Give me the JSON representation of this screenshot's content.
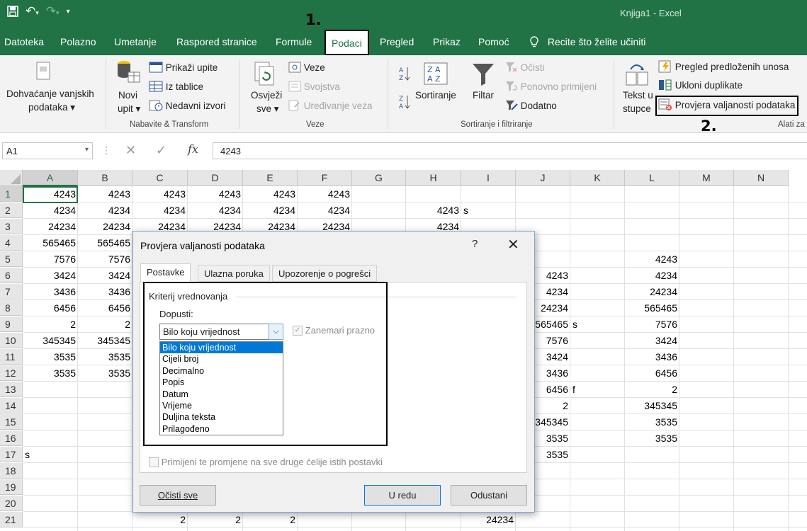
{
  "window": {
    "title": "Knjiga1  -  Excel"
  },
  "annotations": {
    "step1": "1.",
    "step2": "2."
  },
  "tabs": [
    {
      "label": "Datoteka"
    },
    {
      "label": "Polazno"
    },
    {
      "label": "Umetanje"
    },
    {
      "label": "Raspored stranice"
    },
    {
      "label": "Formule"
    },
    {
      "label": "Podaci",
      "active": true
    },
    {
      "label": "Pregled"
    },
    {
      "label": "Prikaz"
    },
    {
      "label": "Pomoć"
    }
  ],
  "tell_me": "Recite što želite učiniti",
  "ribbon": {
    "get_external": [
      "Dohvaćanje vanjskih",
      "podataka ▾"
    ],
    "new_query": [
      "Novi",
      "upit ▾"
    ],
    "show_queries": "Prikaži upite",
    "from_table": "Iz tablice",
    "recent_sources": "Nedavni izvori",
    "group_transform": "Nabavite & Transform",
    "refresh": [
      "Osvježi",
      "sve ▾"
    ],
    "connections": "Veze",
    "properties": "Svojstva",
    "edit_links": "Uređivanje veza",
    "group_connections": "Veze",
    "sort": "Sortiranje",
    "filter": "Filtar",
    "clear": "Očisti",
    "reapply": "Ponovno primijeni",
    "advanced": "Dodatno",
    "group_sort": "Sortiranje i filtriranje",
    "text_to_columns": [
      "Tekst u",
      "stupce"
    ],
    "flash_fill": "Pregled predloženih unosa",
    "remove_duplicates": "Ukloni duplikate",
    "data_validation": "Provjera valjanosti podataka",
    "group_tools": "Alati za"
  },
  "formula_bar": {
    "name_box": "A1",
    "fx": "fx",
    "value": "4243"
  },
  "columns": [
    "A",
    "B",
    "C",
    "D",
    "E",
    "F",
    "G",
    "H",
    "I",
    "J",
    "K",
    "L",
    "M",
    "N"
  ],
  "rows": [
    "1",
    "2",
    "3",
    "4",
    "5",
    "6",
    "7",
    "8",
    "9",
    "10",
    "11",
    "12",
    "13",
    "14",
    "15",
    "16",
    "17",
    "18",
    "19",
    "20",
    "21"
  ],
  "cells": [
    {
      "r": 1,
      "c": 0,
      "v": "4243"
    },
    {
      "r": 1,
      "c": 1,
      "v": "4243"
    },
    {
      "r": 1,
      "c": 2,
      "v": "4243"
    },
    {
      "r": 1,
      "c": 3,
      "v": "4243"
    },
    {
      "r": 1,
      "c": 4,
      "v": "4243"
    },
    {
      "r": 1,
      "c": 5,
      "v": "4243"
    },
    {
      "r": 2,
      "c": 0,
      "v": "4234"
    },
    {
      "r": 2,
      "c": 1,
      "v": "4234"
    },
    {
      "r": 2,
      "c": 2,
      "v": "4234"
    },
    {
      "r": 2,
      "c": 3,
      "v": "4234"
    },
    {
      "r": 2,
      "c": 4,
      "v": "4234"
    },
    {
      "r": 2,
      "c": 5,
      "v": "4234"
    },
    {
      "r": 2,
      "c": 7,
      "v": "4243"
    },
    {
      "r": 2,
      "c": 8,
      "v": "s",
      "l": true
    },
    {
      "r": 3,
      "c": 0,
      "v": "24234"
    },
    {
      "r": 3,
      "c": 1,
      "v": "24234"
    },
    {
      "r": 3,
      "c": 2,
      "v": "24234"
    },
    {
      "r": 3,
      "c": 3,
      "v": "24234"
    },
    {
      "r": 3,
      "c": 4,
      "v": "24234"
    },
    {
      "r": 3,
      "c": 5,
      "v": "24234"
    },
    {
      "r": 3,
      "c": 7,
      "v": "4234"
    },
    {
      "r": 4,
      "c": 0,
      "v": "565465"
    },
    {
      "r": 4,
      "c": 1,
      "v": "565465"
    },
    {
      "r": 5,
      "c": 0,
      "v": "7576"
    },
    {
      "r": 5,
      "c": 1,
      "v": "7576"
    },
    {
      "r": 5,
      "c": 11,
      "v": "4243"
    },
    {
      "r": 6,
      "c": 0,
      "v": "3424"
    },
    {
      "r": 6,
      "c": 1,
      "v": "3424"
    },
    {
      "r": 6,
      "c": 9,
      "v": "4243"
    },
    {
      "r": 6,
      "c": 11,
      "v": "4234"
    },
    {
      "r": 7,
      "c": 0,
      "v": "3436"
    },
    {
      "r": 7,
      "c": 1,
      "v": "3436"
    },
    {
      "r": 7,
      "c": 9,
      "v": "4234"
    },
    {
      "r": 7,
      "c": 11,
      "v": "24234"
    },
    {
      "r": 8,
      "c": 0,
      "v": "6456"
    },
    {
      "r": 8,
      "c": 1,
      "v": "6456"
    },
    {
      "r": 8,
      "c": 9,
      "v": "24234"
    },
    {
      "r": 8,
      "c": 11,
      "v": "565465"
    },
    {
      "r": 9,
      "c": 0,
      "v": "2"
    },
    {
      "r": 9,
      "c": 1,
      "v": "2"
    },
    {
      "r": 9,
      "c": 9,
      "v": "565465"
    },
    {
      "r": 9,
      "c": 10,
      "v": "s",
      "l": true
    },
    {
      "r": 9,
      "c": 11,
      "v": "7576"
    },
    {
      "r": 10,
      "c": 0,
      "v": "345345"
    },
    {
      "r": 10,
      "c": 1,
      "v": "345345"
    },
    {
      "r": 10,
      "c": 9,
      "v": "7576"
    },
    {
      "r": 10,
      "c": 11,
      "v": "3424"
    },
    {
      "r": 11,
      "c": 0,
      "v": "3535"
    },
    {
      "r": 11,
      "c": 1,
      "v": "3535"
    },
    {
      "r": 11,
      "c": 9,
      "v": "3424"
    },
    {
      "r": 11,
      "c": 11,
      "v": "3436"
    },
    {
      "r": 12,
      "c": 0,
      "v": "3535"
    },
    {
      "r": 12,
      "c": 1,
      "v": "3535"
    },
    {
      "r": 12,
      "c": 9,
      "v": "3436"
    },
    {
      "r": 12,
      "c": 11,
      "v": "6456"
    },
    {
      "r": 13,
      "c": 9,
      "v": "6456"
    },
    {
      "r": 13,
      "c": 10,
      "v": "f",
      "l": true
    },
    {
      "r": 13,
      "c": 11,
      "v": "2"
    },
    {
      "r": 14,
      "c": 9,
      "v": "2"
    },
    {
      "r": 14,
      "c": 11,
      "v": "345345"
    },
    {
      "r": 15,
      "c": 9,
      "v": "345345"
    },
    {
      "r": 15,
      "c": 11,
      "v": "3535"
    },
    {
      "r": 16,
      "c": 9,
      "v": "3535"
    },
    {
      "r": 16,
      "c": 11,
      "v": "3535"
    },
    {
      "r": 17,
      "c": 0,
      "v": "s",
      "l": true
    },
    {
      "r": 17,
      "c": 9,
      "v": "3535"
    },
    {
      "r": 21,
      "c": 2,
      "v": "2"
    },
    {
      "r": 21,
      "c": 3,
      "v": "2"
    },
    {
      "r": 21,
      "c": 4,
      "v": "2"
    },
    {
      "r": 21,
      "c": 8,
      "v": "24234"
    }
  ],
  "dialog": {
    "title": "Provjera valjanosti podataka",
    "help": "?",
    "close": "✕",
    "tabs": [
      "Postavke",
      "Ulazna poruka",
      "Upozorenje o pogrešci"
    ],
    "criteria_label": "Kriterij vrednovanja",
    "allow_label": "Dopusti:",
    "allow_value": "Bilo koju vrijednost",
    "ignore_blank": "Zanemari prazno",
    "options": [
      "Bilo koju vrijednost",
      "Cijeli broj",
      "Decimalno",
      "Popis",
      "Datum",
      "Vrijeme",
      "Duljina teksta",
      "Prilagođeno"
    ],
    "apply_all": "Primijeni te promjene na sve druge ćelije istih postavki",
    "clear_all": "Očisti sve",
    "ok": "U redu",
    "cancel": "Odustani"
  },
  "colors": {
    "excel_green": "#217346",
    "selection_blue": "#0078d7"
  }
}
